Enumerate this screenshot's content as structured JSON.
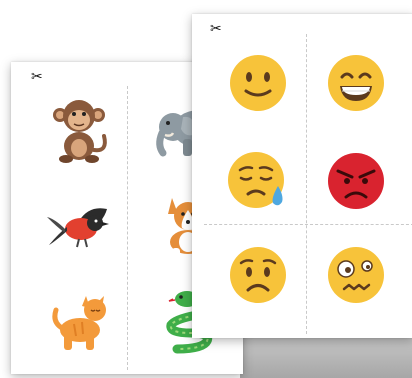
{
  "cut_marker_glyph": "✂",
  "back_sheet": {
    "cards": [
      {
        "icon": "monkey-icon"
      },
      {
        "icon": "elephant-icon"
      },
      {
        "icon": "bird-icon"
      },
      {
        "icon": "corgi-dog-icon"
      },
      {
        "icon": "cat-icon"
      },
      {
        "icon": "snake-icon"
      }
    ]
  },
  "front_sheet": {
    "cards": [
      {
        "icon": "slightly-smiling-face-icon"
      },
      {
        "icon": "grinning-face-icon"
      },
      {
        "icon": "sad-sweat-face-icon"
      },
      {
        "icon": "angry-face-icon"
      },
      {
        "icon": "worried-face-icon"
      },
      {
        "icon": "dizzy-woozy-face-icon"
      }
    ]
  },
  "colors": {
    "emoji_yellow": "#F7C33A",
    "angry_red": "#D9232F",
    "monkey_brown": "#8A5A3C",
    "elephant_gray": "#8E9AA2",
    "bird_red": "#E2402F",
    "corgi_orange": "#E58E3A",
    "cat_orange": "#F39A3B",
    "snake_green": "#3FAE49"
  }
}
